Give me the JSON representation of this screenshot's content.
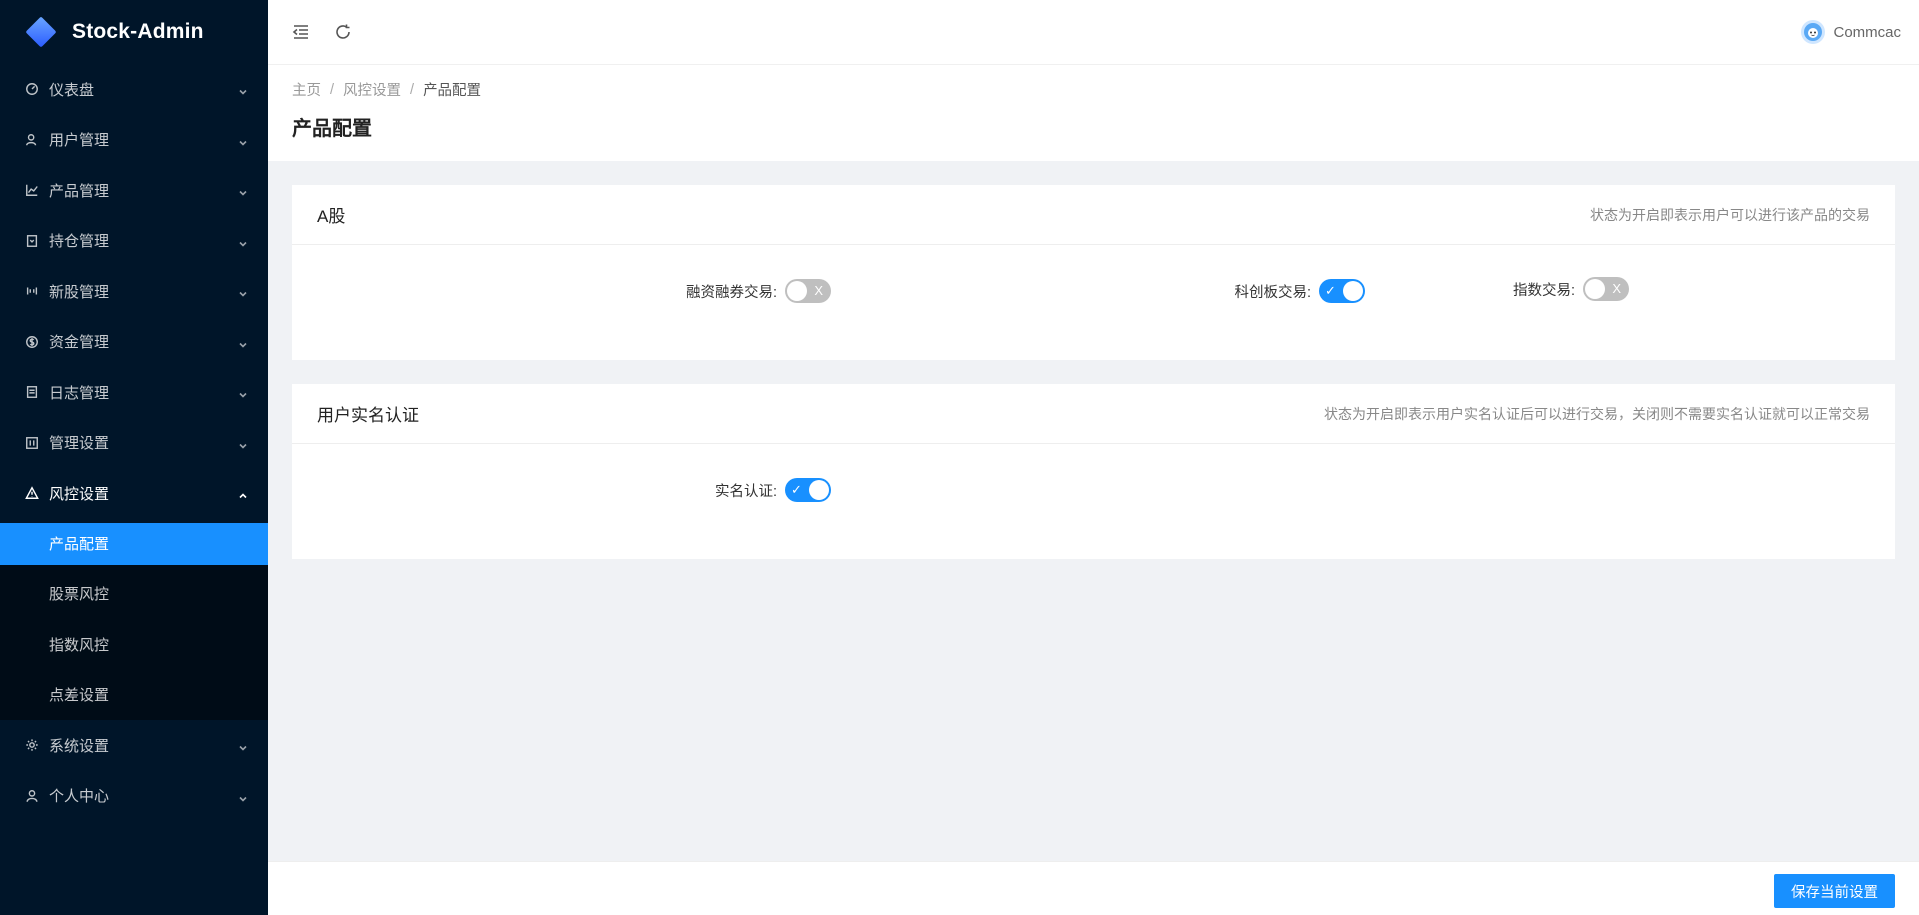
{
  "app": {
    "title": "Stock-Admin"
  },
  "sidebar": {
    "items": [
      {
        "label": "仪表盘",
        "icon": "dashboard-icon"
      },
      {
        "label": "用户管理",
        "icon": "users-icon"
      },
      {
        "label": "产品管理",
        "icon": "chart-icon"
      },
      {
        "label": "持仓管理",
        "icon": "position-icon"
      },
      {
        "label": "新股管理",
        "icon": "ipo-icon"
      },
      {
        "label": "资金管理",
        "icon": "money-icon"
      },
      {
        "label": "日志管理",
        "icon": "log-icon"
      },
      {
        "label": "管理设置",
        "icon": "settings-panel-icon"
      },
      {
        "label": "风控设置",
        "icon": "warning-icon",
        "expanded": true
      },
      {
        "label": "系统设置",
        "icon": "gear-icon"
      },
      {
        "label": "个人中心",
        "icon": "user-icon"
      }
    ],
    "submenu": [
      {
        "label": "产品配置",
        "active": true
      },
      {
        "label": "股票风控"
      },
      {
        "label": "指数风控"
      },
      {
        "label": "点差设置"
      }
    ]
  },
  "header": {
    "username": "Commcac"
  },
  "breadcrumb": [
    "主页",
    "风控设置",
    "产品配置"
  ],
  "breadcrumb_sep": "/",
  "page_title": "产品配置",
  "cards": [
    {
      "title": "A股",
      "hint": "状态为开启即表示用户可以进行该产品的交易",
      "fields": [
        {
          "label": "融资融券交易:",
          "on": false,
          "switch_text": "X"
        },
        {
          "label": "科创板交易:",
          "on": true,
          "switch_text": "✓"
        },
        {
          "label": "指数交易:",
          "on": false,
          "switch_text": "X"
        }
      ]
    },
    {
      "title": "用户实名认证",
      "hint": "状态为开启即表示用户实名认证后可以进行交易，关闭则不需要实名认证就可以正常交易",
      "fields": [
        {
          "label": "实名认证:",
          "on": true,
          "switch_text": "✓"
        }
      ]
    }
  ],
  "footer": {
    "save_label": "保存当前设置"
  },
  "colors": {
    "primary": "#1890ff",
    "sidebar_bg": "#001529",
    "submenu_bg": "#000c17",
    "switch_off": "#bfbfbf"
  }
}
